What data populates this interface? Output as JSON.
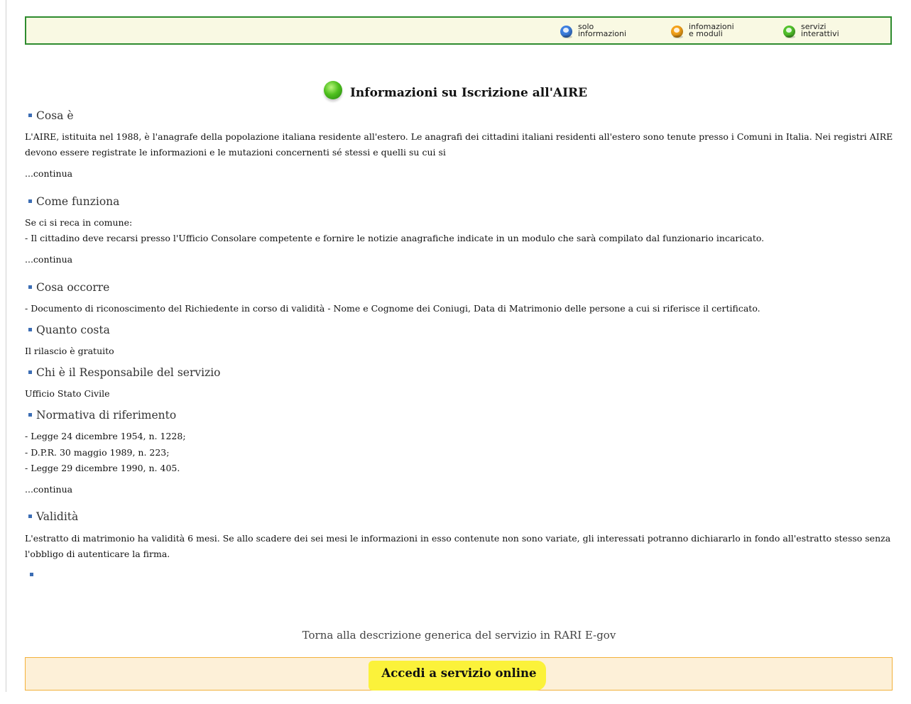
{
  "legend": {
    "items": [
      {
        "label": "solo\ninformazioni",
        "color": "#3d7fe0"
      },
      {
        "label": "infomazioni\ne moduli",
        "color": "#f4a21a"
      },
      {
        "label": "servizi\ninterattivi",
        "color": "#52c22b"
      }
    ]
  },
  "page": {
    "title": "Informazioni su Iscrizione all'AIRE"
  },
  "sections": {
    "cosa_e": {
      "heading": "Cosa è",
      "text": "L'AIRE, istituita nel 1988, è l'anagrafe della popolazione italiana residente all'estero. Le anagrafi dei cittadini italiani residenti all'estero sono tenute presso i Comuni in Italia. Nei registri AIRE devono essere registrate le informazioni e le mutazioni concernenti sé stessi e quelli su cui si",
      "more": "...continua"
    },
    "come_funziona": {
      "heading": "Come funziona",
      "line1": "Se ci si reca in comune:",
      "line2": "- Il cittadino deve recarsi presso l'Ufficio Consolare competente e fornire le notizie anagrafiche indicate in un modulo che sarà compilato dal funzionario incaricato.",
      "more": "...continua"
    },
    "cosa_occorre": {
      "heading": "Cosa occorre",
      "text": "- Documento di riconoscimento del Richiedente in corso di validità - Nome e Cognome dei Coniugi, Data di Matrimonio delle persone a cui si riferisce il certificato."
    },
    "quanto_costa": {
      "heading": "Quanto costa",
      "text": "Il rilascio è gratuito"
    },
    "responsabile": {
      "heading": "Chi è il Responsabile del servizio",
      "text": "Ufficio Stato Civile"
    },
    "normativa": {
      "heading": "Normativa di riferimento",
      "line1": "- Legge 24 dicembre 1954, n. 1228;",
      "line2": "- D.P.R. 30 maggio 1989, n. 223;",
      "line3": "- Legge 29 dicembre 1990, n. 405.",
      "more": "...continua"
    },
    "validita": {
      "heading": "Validità",
      "text": "L'estratto di matrimonio ha validità 6 mesi. Se allo scadere dei sei mesi le informazioni in esso contenute non sono variate, gli interessati potranno dichiararlo in fondo all'estratto stesso senza l'obbligo di autenticare la firma."
    }
  },
  "footer": {
    "back_link": "Torna alla descrizione generica del servizio in RARI E-gov",
    "access_link": "Accedi a servizio online",
    "highlight_color": "#fbf23a"
  }
}
